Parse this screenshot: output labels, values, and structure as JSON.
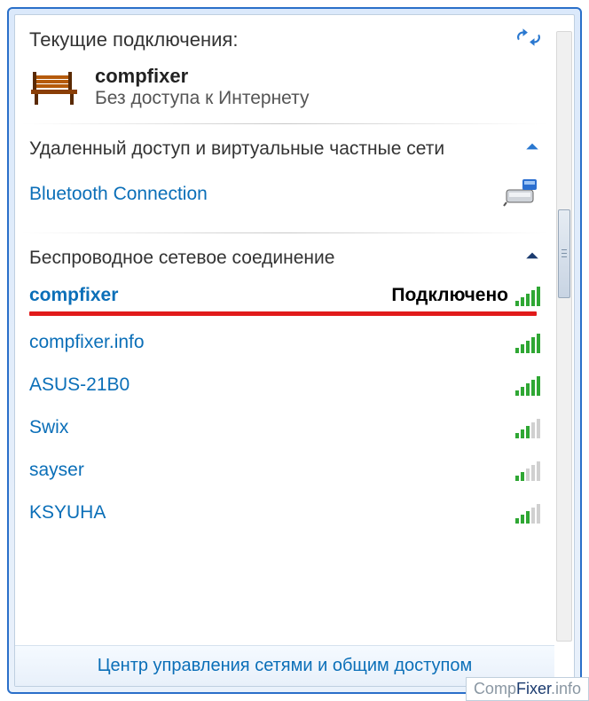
{
  "header": {
    "title": "Текущие подключения:"
  },
  "current_connection": {
    "name": "compfixer",
    "status": "Без доступа к Интернету"
  },
  "sections": {
    "dialup": {
      "title": "Удаленный доступ и виртуальные частные сети",
      "items": [
        {
          "name": "Bluetooth Connection"
        }
      ]
    },
    "wireless": {
      "title": "Беспроводное сетевое соединение",
      "items": [
        {
          "name": "compfixer",
          "status": "Подключено",
          "signal": 5,
          "highlighted": true
        },
        {
          "name": "compfixer.info",
          "signal": 5
        },
        {
          "name": "ASUS-21B0",
          "signal": 5
        },
        {
          "name": "Swix",
          "signal": 3
        },
        {
          "name": "sayser",
          "signal": 2
        },
        {
          "name": "KSYUHA",
          "signal": 3
        }
      ]
    }
  },
  "footer": {
    "link": "Центр управления сетями и общим доступом"
  },
  "watermark": {
    "part1": "Comp",
    "part2": "Fixer",
    "part3": ".info"
  },
  "colors": {
    "link_blue": "#0b6fb8",
    "highlight_red": "#e11a1a",
    "signal_green": "#2fa734"
  }
}
